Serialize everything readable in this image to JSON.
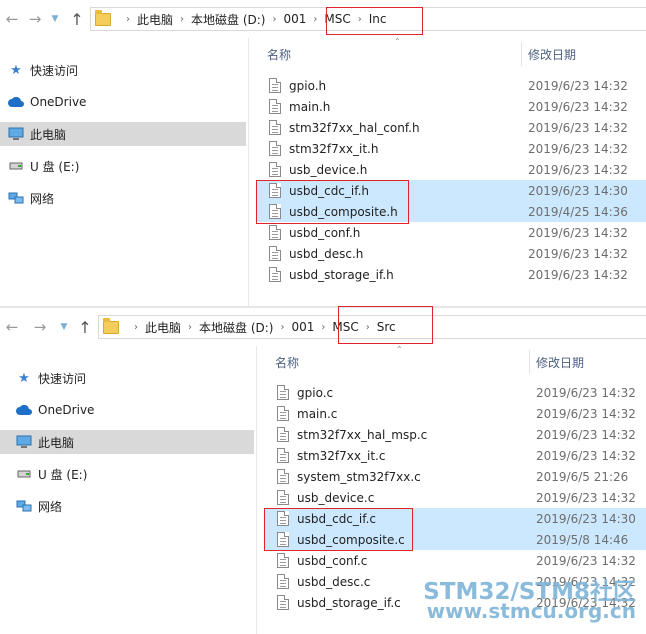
{
  "top": {
    "breadcrumb": [
      "此电脑",
      "本地磁盘 (D:)",
      "001",
      "MSC",
      "Inc"
    ],
    "columns": {
      "name": "名称",
      "date": "修改日期"
    },
    "files": [
      {
        "name": "gpio.h",
        "date": "2019/6/23 14:32",
        "selected": false
      },
      {
        "name": "main.h",
        "date": "2019/6/23 14:32",
        "selected": false
      },
      {
        "name": "stm32f7xx_hal_conf.h",
        "date": "2019/6/23 14:32",
        "selected": false
      },
      {
        "name": "stm32f7xx_it.h",
        "date": "2019/6/23 14:32",
        "selected": false
      },
      {
        "name": "usb_device.h",
        "date": "2019/6/23 14:32",
        "selected": false
      },
      {
        "name": "usbd_cdc_if.h",
        "date": "2019/6/23 14:30",
        "selected": true
      },
      {
        "name": "usbd_composite.h",
        "date": "2019/4/25 14:36",
        "selected": true
      },
      {
        "name": "usbd_conf.h",
        "date": "2019/6/23 14:32",
        "selected": false
      },
      {
        "name": "usbd_desc.h",
        "date": "2019/6/23 14:32",
        "selected": false
      },
      {
        "name": "usbd_storage_if.h",
        "date": "2019/6/23 14:32",
        "selected": false
      }
    ]
  },
  "bottom": {
    "breadcrumb": [
      "此电脑",
      "本地磁盘 (D:)",
      "001",
      "MSC",
      "Src"
    ],
    "columns": {
      "name": "名称",
      "date": "修改日期"
    },
    "files": [
      {
        "name": "gpio.c",
        "date": "2019/6/23 14:32",
        "selected": false
      },
      {
        "name": "main.c",
        "date": "2019/6/23 14:32",
        "selected": false
      },
      {
        "name": "stm32f7xx_hal_msp.c",
        "date": "2019/6/23 14:32",
        "selected": false
      },
      {
        "name": "stm32f7xx_it.c",
        "date": "2019/6/23 14:32",
        "selected": false
      },
      {
        "name": "system_stm32f7xx.c",
        "date": "2019/6/5 21:26",
        "selected": false
      },
      {
        "name": "usb_device.c",
        "date": "2019/6/23 14:32",
        "selected": false
      },
      {
        "name": "usbd_cdc_if.c",
        "date": "2019/6/23 14:30",
        "selected": true
      },
      {
        "name": "usbd_composite.c",
        "date": "2019/5/8 14:46",
        "selected": true
      },
      {
        "name": "usbd_conf.c",
        "date": "2019/6/23 14:32",
        "selected": false
      },
      {
        "name": "usbd_desc.c",
        "date": "2019/6/23 14:32",
        "selected": false
      },
      {
        "name": "usbd_storage_if.c",
        "date": "2019/6/23 14:32",
        "selected": false
      }
    ]
  },
  "nav_tree": [
    {
      "label": "快速访问",
      "icon": "star-icon",
      "selected": false
    },
    {
      "label": "OneDrive",
      "icon": "cloud-icon",
      "selected": false
    },
    {
      "label": "此电脑",
      "icon": "computer-icon",
      "selected": true
    },
    {
      "label": "U 盘 (E:)",
      "icon": "usb-drive-icon",
      "selected": false
    },
    {
      "label": "网络",
      "icon": "network-icon",
      "selected": false
    }
  ],
  "watermark": {
    "line1": "STM32/STM8社区",
    "line2": "www.stmcu.org.cn"
  },
  "colors": {
    "selection": "#cce8ff",
    "tree_selection": "#d9d9d9",
    "highlight_box": "#e0242c",
    "watermark": "#7fb4d8"
  }
}
